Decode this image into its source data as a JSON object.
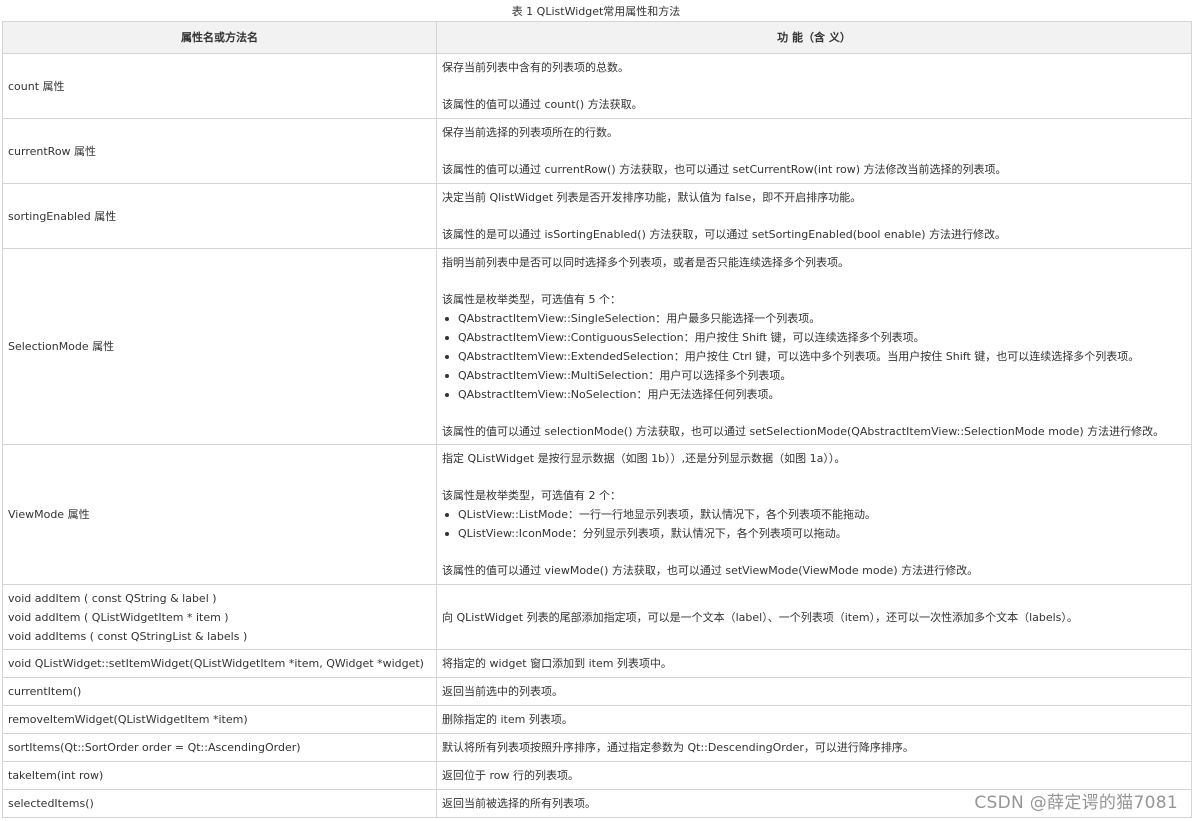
{
  "caption": "表 1 QListWidget常用属性和方法",
  "headers": {
    "col1": "属性名或方法名",
    "col2": "功 能（含 义）"
  },
  "rows": [
    {
      "name": [
        "count 属性"
      ],
      "desc": [
        "保存当前列表中含有的列表项的总数。",
        "",
        "该属性的值可以通过 count() 方法获取。"
      ]
    },
    {
      "name": [
        "currentRow 属性"
      ],
      "desc": [
        "保存当前选择的列表项所在的行数。",
        "",
        "该属性的值可以通过 currentRow() 方法获取，也可以通过 setCurrentRow(int row) 方法修改当前选择的列表项。"
      ]
    },
    {
      "name": [
        "sortingEnabled 属性"
      ],
      "desc": [
        "决定当前 QlistWidget 列表是否开发排序功能，默认值为 false，即不开启排序功能。",
        "",
        "该属性的是可以通过 isSortingEnabled() 方法获取，可以通过 setSortingEnabled(bool enable) 方法进行修改。"
      ]
    },
    {
      "name": [
        "SelectionMode 属性"
      ],
      "desc_top": [
        "指明当前列表中是否可以同时选择多个列表项，或者是否只能连续选择多个列表项。",
        "",
        "该属性是枚举类型，可选值有 5 个："
      ],
      "bullets": [
        "QAbstractItemView::SingleSelection：用户最多只能选择一个列表项。",
        "QAbstractItemView::ContiguousSelection：用户按住 Shift 键，可以连续选择多个列表项。",
        "QAbstractItemView::ExtendedSelection：用户按住 Ctrl 键，可以选中多个列表项。当用户按住 Shift 键，也可以连续选择多个列表项。",
        "QAbstractItemView::MultiSelection：用户可以选择多个列表项。",
        "QAbstractItemView::NoSelection：用户无法选择任何列表项。"
      ],
      "desc_bottom": [
        "",
        "该属性的值可以通过 selectionMode() 方法获取，也可以通过 setSelectionMode(QAbstractItemView::SelectionMode mode) 方法进行修改。"
      ]
    },
    {
      "name": [
        "ViewMode 属性"
      ],
      "desc_top": [
        "指定 QListWidget 是按行显示数据（如图 1b））,还是分列显示数据（如图 1a））。",
        "",
        "该属性是枚举类型，可选值有 2 个："
      ],
      "bullets": [
        "QListView::ListMode：一行一行地显示列表项，默认情况下，各个列表项不能拖动。",
        "QListView::IconMode：分列显示列表项，默认情况下，各个列表项可以拖动。"
      ],
      "desc_bottom": [
        "",
        "该属性的值可以通过 viewMode() 方法获取，也可以通过 setViewMode(ViewMode mode) 方法进行修改。"
      ]
    },
    {
      "name": [
        "void addItem ( const QString & label )",
        "void addItem ( QListWidgetItem * item )",
        "void addItems ( const QStringList & labels )"
      ],
      "desc": [
        "向 QListWidget 列表的尾部添加指定项，可以是一个文本（label）、一个列表项（item），还可以一次性添加多个文本（labels）。"
      ]
    },
    {
      "name": [
        "void QListWidget::setItemWidget(QListWidgetItem *item, QWidget *widget)"
      ],
      "desc": [
        "将指定的 widget 窗口添加到 item 列表项中。"
      ]
    },
    {
      "name": [
        "currentItem()"
      ],
      "desc": [
        "返回当前选中的列表项。"
      ]
    },
    {
      "name": [
        "removeItemWidget(QListWidgetItem *item)"
      ],
      "desc": [
        "删除指定的 item 列表项。"
      ]
    },
    {
      "name": [
        "sortItems(Qt::SortOrder order = Qt::AscendingOrder)"
      ],
      "desc": [
        "默认将所有列表项按照升序排序，通过指定参数为 Qt::DescendingOrder，可以进行降序排序。"
      ]
    },
    {
      "name": [
        "takeItem(int row)"
      ],
      "desc": [
        "返回位于 row 行的列表项。"
      ]
    },
    {
      "name": [
        "selectedItems()"
      ],
      "desc": [
        "返回当前被选择的所有列表项。"
      ]
    }
  ],
  "watermark": "CSDN @薛定谔的猫7081"
}
